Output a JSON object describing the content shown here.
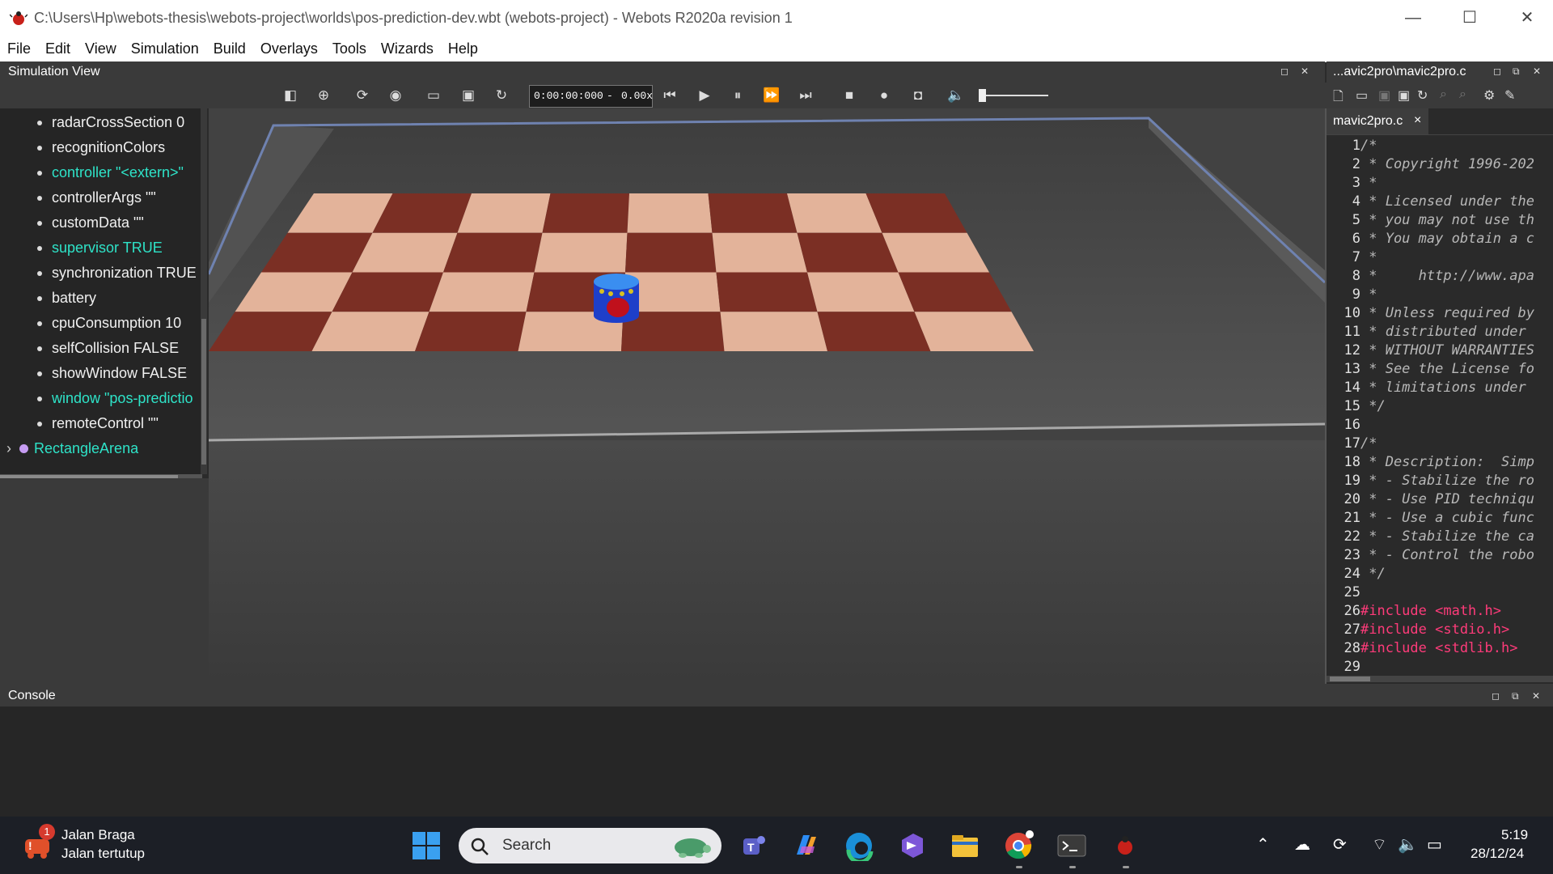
{
  "window": {
    "title": "C:\\Users\\Hp\\webots-thesis\\webots-project\\worlds\\pos-prediction-dev.wbt (webots-project) - Webots R2020a revision 1",
    "minimize": "—",
    "maximize": "☐",
    "close": "✕"
  },
  "menu": [
    "File",
    "Edit",
    "View",
    "Simulation",
    "Build",
    "Overlays",
    "Tools",
    "Wizards",
    "Help"
  ],
  "simulation_view": {
    "label": "Simulation View",
    "time": "0:00:00:000",
    "sep": "-",
    "speed": "0.00x",
    "volume_fraction": 0.0
  },
  "scene_tree": {
    "items": [
      {
        "label": "radarCrossSection 0",
        "highlight": false
      },
      {
        "label": "recognitionColors",
        "highlight": false
      },
      {
        "label": "controller \"<extern>\"",
        "highlight": true
      },
      {
        "label": "controllerArgs \"\"",
        "highlight": false
      },
      {
        "label": "customData \"\"",
        "highlight": false
      },
      {
        "label": "supervisor TRUE",
        "highlight": true
      },
      {
        "label": "synchronization TRUE",
        "highlight": false
      },
      {
        "label": "battery",
        "highlight": false
      },
      {
        "label": "cpuConsumption 10",
        "highlight": false
      },
      {
        "label": "selfCollision FALSE",
        "highlight": false
      },
      {
        "label": "showWindow FALSE",
        "highlight": false
      },
      {
        "label": "window \"pos-predictio",
        "highlight": true
      },
      {
        "label": "remoteControl \"\"",
        "highlight": false
      }
    ],
    "arena_node": "RectangleArena",
    "arena_arrow": "›"
  },
  "editor": {
    "title": "...avic2pro\\mavic2pro.c",
    "tab": "mavic2pro.c",
    "tab_close": "×",
    "lines": [
      {
        "n": "1",
        "t": "/*",
        "k": "c"
      },
      {
        "n": "2",
        "t": " * Copyright 1996-202",
        "k": "c"
      },
      {
        "n": "3",
        "t": " *",
        "k": "c"
      },
      {
        "n": "4",
        "t": " * Licensed under the",
        "k": "c"
      },
      {
        "n": "5",
        "t": " * you may not use th",
        "k": "c"
      },
      {
        "n": "6",
        "t": " * You may obtain a c",
        "k": "c"
      },
      {
        "n": "7",
        "t": " *",
        "k": "c"
      },
      {
        "n": "8",
        "t": " *     http://www.apa",
        "k": "c"
      },
      {
        "n": "9",
        "t": " *",
        "k": "c"
      },
      {
        "n": "10",
        "t": " * Unless required by",
        "k": "c"
      },
      {
        "n": "11",
        "t": " * distributed under",
        "k": "c"
      },
      {
        "n": "12",
        "t": " * WITHOUT WARRANTIES",
        "k": "c"
      },
      {
        "n": "13",
        "t": " * See the License fo",
        "k": "c"
      },
      {
        "n": "14",
        "t": " * limitations under",
        "k": "c"
      },
      {
        "n": "15",
        "t": " */",
        "k": "c"
      },
      {
        "n": "16",
        "t": "",
        "k": "c"
      },
      {
        "n": "17",
        "t": "/*",
        "k": "c"
      },
      {
        "n": "18",
        "t": " * Description:  Simp",
        "k": "c"
      },
      {
        "n": "19",
        "t": " * - Stabilize the ro",
        "k": "c"
      },
      {
        "n": "20",
        "t": " * - Use PID techniqu",
        "k": "c"
      },
      {
        "n": "21",
        "t": " * - Use a cubic func",
        "k": "c"
      },
      {
        "n": "22",
        "t": " * - Stabilize the ca",
        "k": "c"
      },
      {
        "n": "23",
        "t": " * - Control the robo",
        "k": "c"
      },
      {
        "n": "24",
        "t": " */",
        "k": "c"
      },
      {
        "n": "25",
        "t": "",
        "k": "c"
      },
      {
        "n": "26",
        "t": "#include <math.h>",
        "k": "i"
      },
      {
        "n": "27",
        "t": "#include <stdio.h>",
        "k": "i"
      },
      {
        "n": "28",
        "t": "#include <stdlib.h>",
        "k": "i"
      },
      {
        "n": "29",
        "t": "",
        "k": "c"
      }
    ]
  },
  "console": {
    "label": "Console"
  },
  "taskbar": {
    "notif_title": "Jalan Braga",
    "notif_sub": "Jalan tertutup",
    "notif_badge": "1",
    "search_placeholder": "Search",
    "time": "5:19",
    "date": "28/12/24"
  },
  "colors": {
    "accent_cyan": "#2ee3c8",
    "include_pink": "#ff3b7a",
    "board_dark": "#7b2f24",
    "board_light": "#e3b39a"
  }
}
